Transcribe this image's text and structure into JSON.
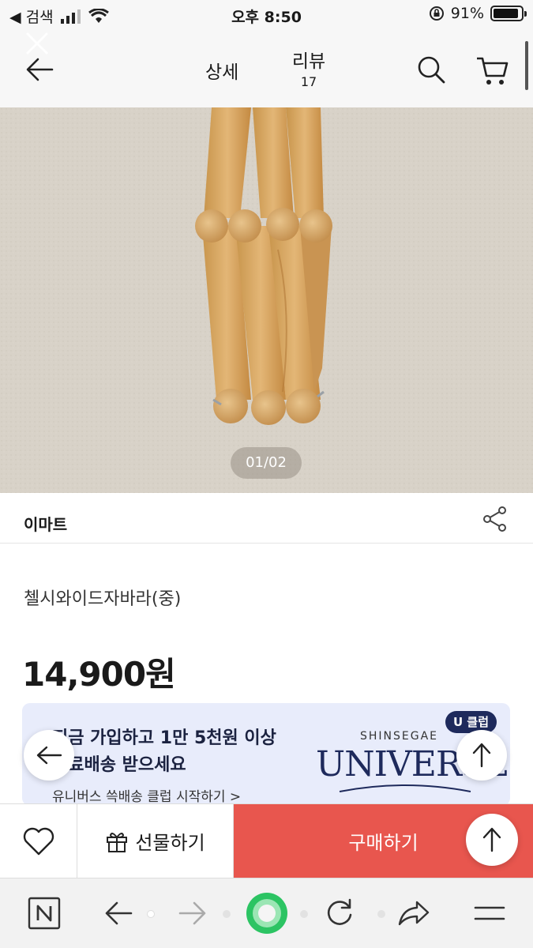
{
  "status_bar": {
    "back_app": "◀ 검색",
    "time": "오후 8:50",
    "battery": "91%",
    "battery_level": 0.91
  },
  "nav": {
    "tab_detail": "상세",
    "tab_review": "리뷰",
    "review_count": "17"
  },
  "gallery": {
    "pager": "01/02"
  },
  "seller": {
    "name": "이마트"
  },
  "product": {
    "title": "첼시와이드자바라(중)",
    "price": "14,900원"
  },
  "promo": {
    "line1": "지금 가입하고 1만 5천원 이상",
    "line2": "무료배송 받으세요",
    "link": "유니버스 쓱배송 클럽 시작하기 >",
    "brand_small": "SHINSEGAE",
    "brand": "UNIVERSE",
    "badge": "U 클럽"
  },
  "buybar": {
    "gift_label": "선물하기",
    "buy_label": "구매하기"
  },
  "colors": {
    "buy": "#e8564e",
    "brand_navy": "#1e2a5c",
    "promo_bg": "#e8ecfb"
  }
}
